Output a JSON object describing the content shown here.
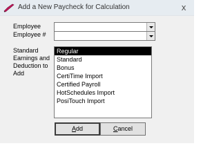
{
  "window": {
    "title": "Add a New Paycheck for Calculation",
    "close_glyph": "x",
    "icon": "pen-icon"
  },
  "form": {
    "employee_label": "Employee",
    "employee_value": "",
    "employee_num_label": "Employee #",
    "employee_num_value": "",
    "earnings_label_line1": "Standard",
    "earnings_label_line2": "Earnings and",
    "earnings_label_line3": "Deduction to",
    "earnings_label_line4": "Add"
  },
  "earnings_list": {
    "selected_index": 0,
    "items": [
      "Regular",
      "Standard",
      "Bonus",
      "CertiTime Import",
      "Certified Payroll",
      "HotSchedules Import",
      "PosiTouch Import"
    ]
  },
  "buttons": {
    "add_label": "Add",
    "add_mnemonic": "A",
    "add_rest": "dd",
    "cancel_label": "Cancel",
    "cancel_mnemonic": "C",
    "cancel_rest": "ancel"
  },
  "colors": {
    "selection_bg": "#000000",
    "dialog_bg": "#f0f0f0",
    "titlebar_bg": "#e6ecf1"
  }
}
